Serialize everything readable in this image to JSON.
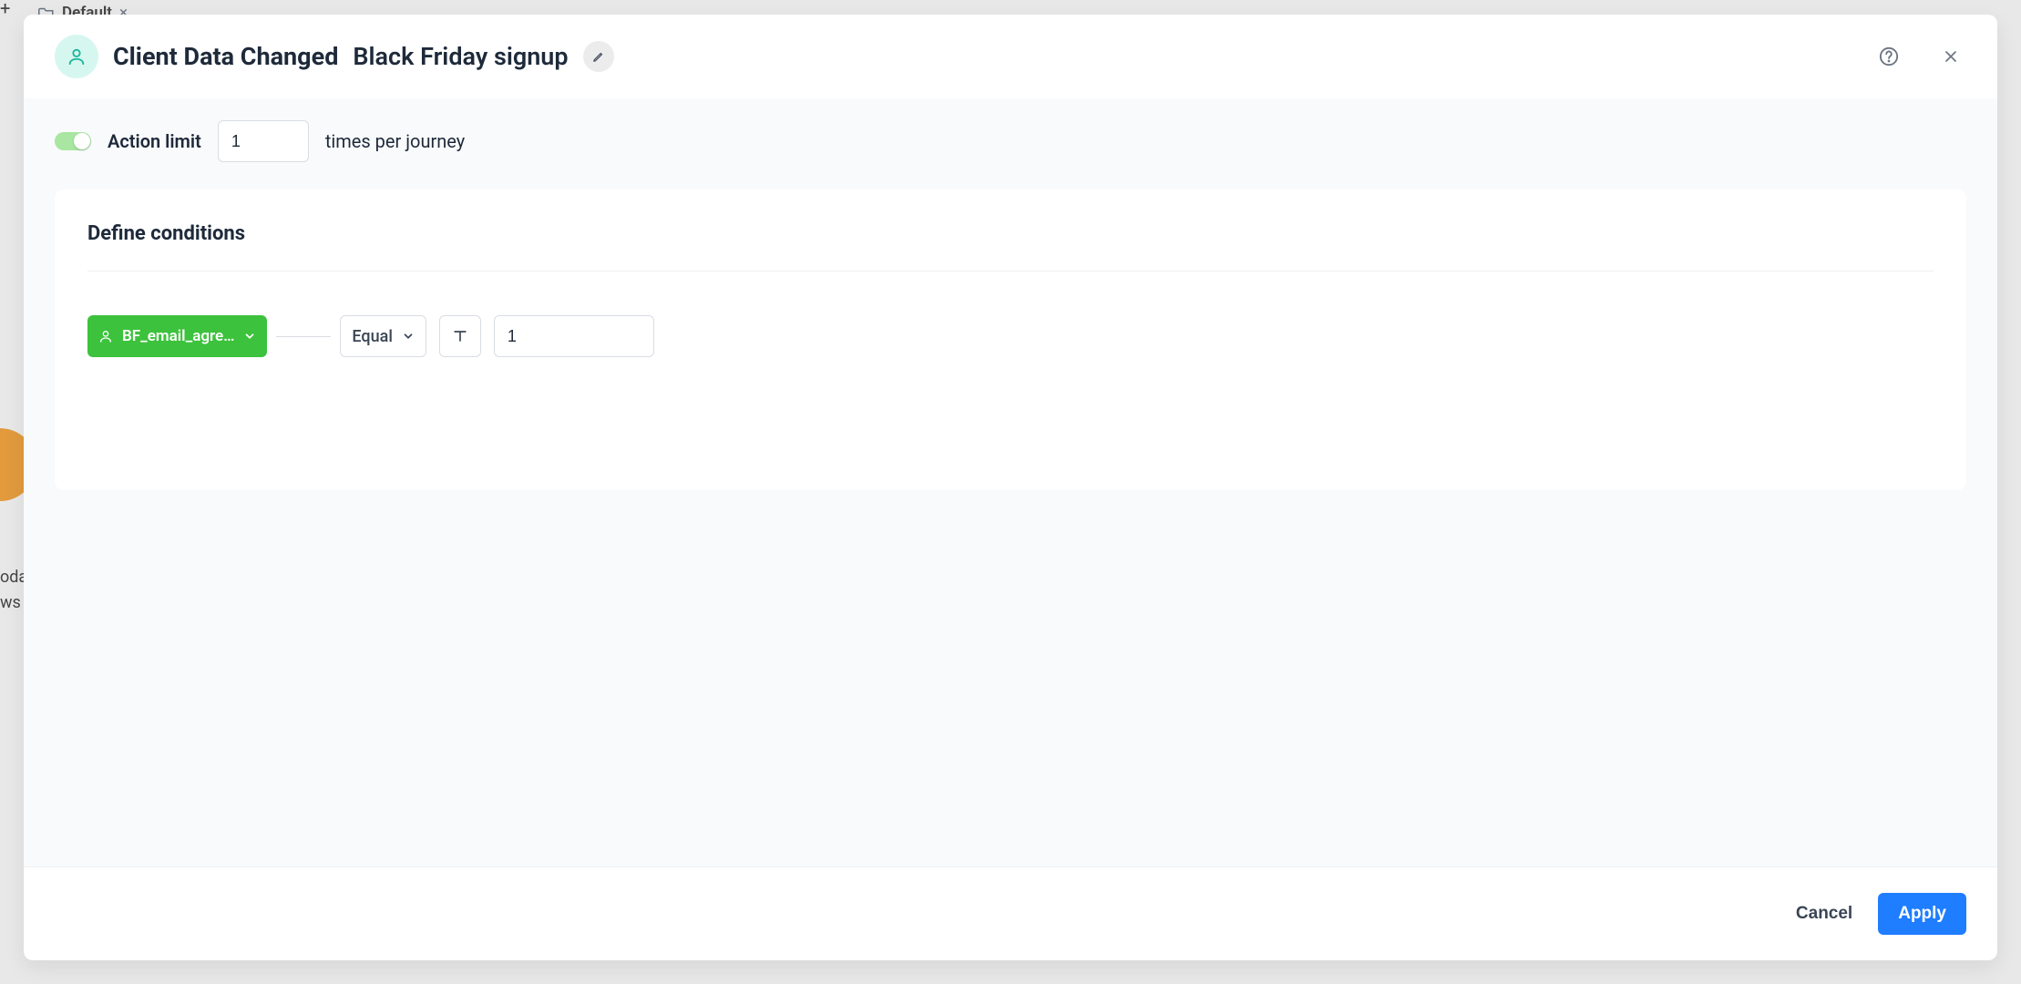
{
  "background": {
    "tab_label": "Default"
  },
  "header": {
    "title": "Client Data Changed",
    "subtitle": "Black Friday signup"
  },
  "action_limit": {
    "label": "Action limit",
    "value": "1",
    "suffix": "times per journey",
    "enabled": true
  },
  "conditions": {
    "heading": "Define conditions",
    "rows": [
      {
        "field_label": "BF_email_agre…",
        "operator": "Equal",
        "value": "1"
      }
    ]
  },
  "footer": {
    "cancel": "Cancel",
    "apply": "Apply"
  }
}
